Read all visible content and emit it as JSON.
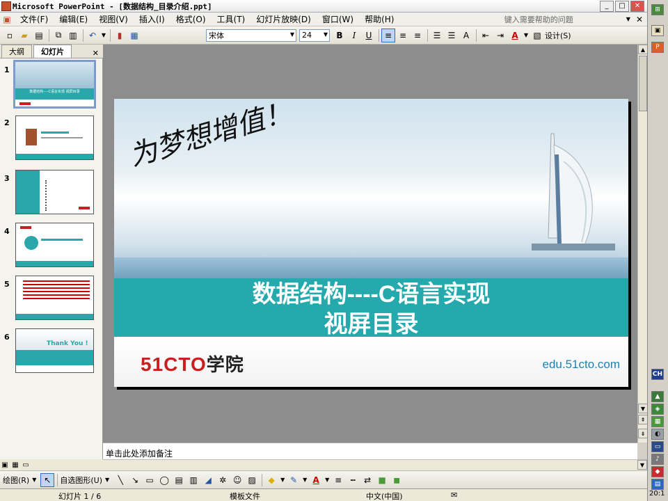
{
  "window": {
    "title": "Microsoft PowerPoint - [数据结构_目录介绍.ppt]"
  },
  "menu": {
    "items": [
      "文件(F)",
      "编辑(E)",
      "视图(V)",
      "插入(I)",
      "格式(O)",
      "工具(T)",
      "幻灯片放映(D)",
      "窗口(W)",
      "帮助(H)"
    ],
    "help_placeholder": "键入需要帮助的问题"
  },
  "toolbar": {
    "font_name": "宋体",
    "font_size": "24",
    "design_label": "设计(S)",
    "bold": "B",
    "italic": "I",
    "underline": "U"
  },
  "left_pane": {
    "tabs": [
      "大纲",
      "幻灯片"
    ],
    "active_tab": "幻灯片",
    "slide_numbers": [
      "1",
      "2",
      "3",
      "4",
      "5",
      "6"
    ],
    "thumb1_title": "数据结构----C语言实现 视屏目录",
    "thumb6_text": "Thank You !"
  },
  "slide": {
    "slogan": "为梦想增值！",
    "title_line1": "数据结构----C语言实现",
    "title_line2": "视屏目录",
    "logo_latin": "51CTO",
    "logo_cn": "学院",
    "url": "edu.51cto.com"
  },
  "notes": {
    "placeholder": "单击此处添加备注"
  },
  "drawing_toolbar": {
    "draw_label": "绘图(R)",
    "autoshape_label": "自选图形(U)"
  },
  "status": {
    "slide_position": "幻灯片 1 / 6",
    "template": "模板文件",
    "language": "中文(中国)"
  },
  "taskbar": {
    "ime": "CH",
    "clock": "20:1"
  },
  "colors": {
    "teal_band": "#25a9ad",
    "logo_red": "#c6201f",
    "url_blue": "#1f7fae"
  }
}
